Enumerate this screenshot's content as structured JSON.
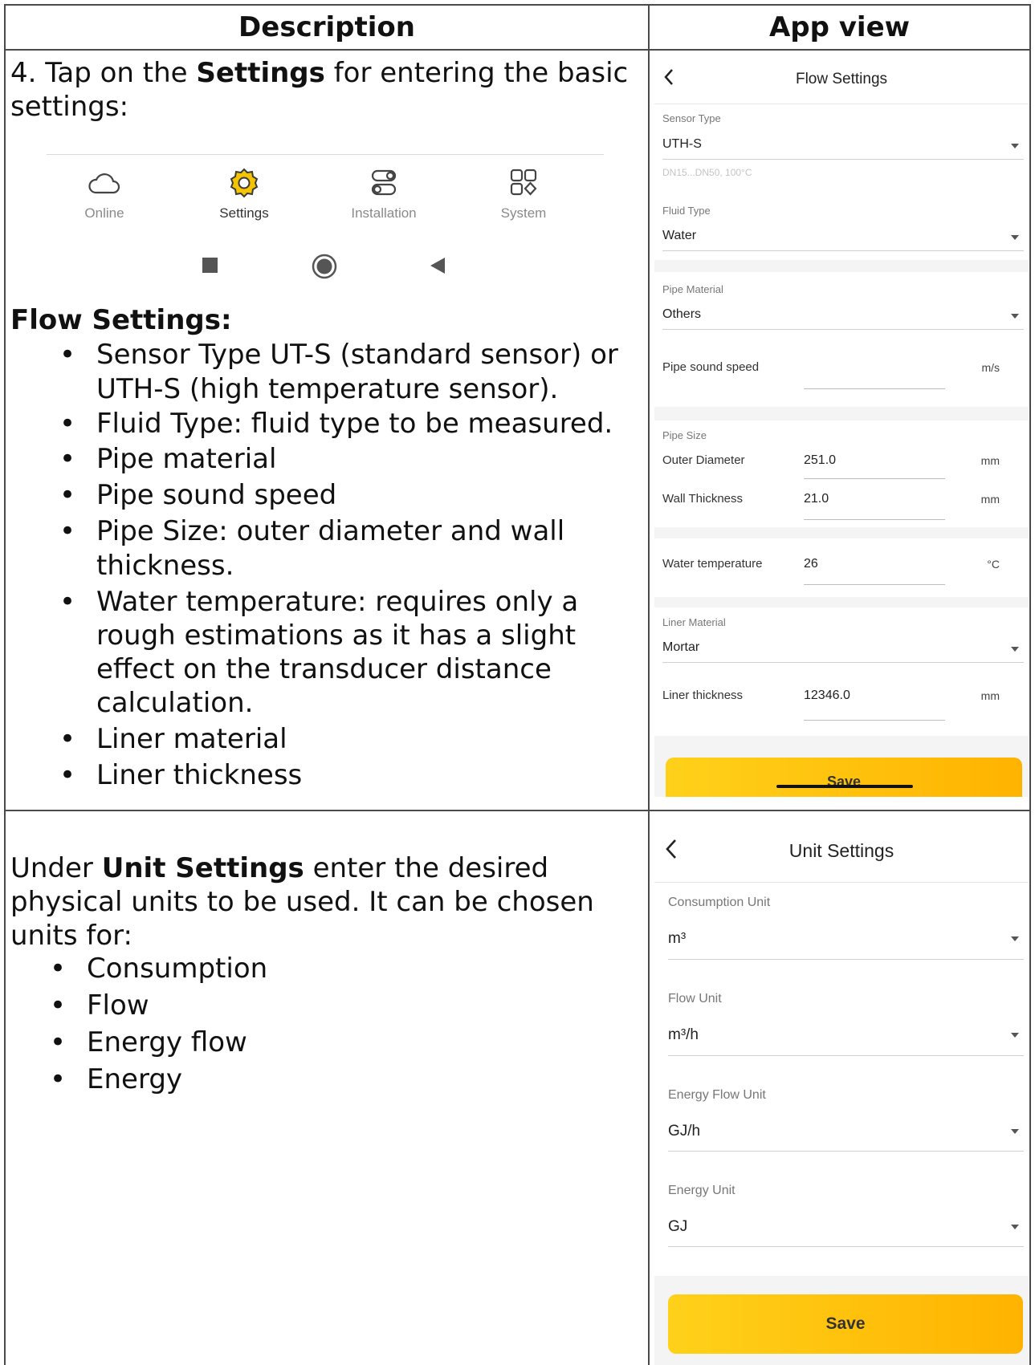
{
  "headers": {
    "description": "Description",
    "app_view": "App view"
  },
  "row1": {
    "intro_prefix": "4. Tap on the ",
    "intro_bold": "Settings",
    "intro_suffix": " for entering the basic settings:",
    "nav": [
      {
        "label": "Online",
        "icon": "cloud-icon"
      },
      {
        "label": "Settings",
        "icon": "gear-icon"
      },
      {
        "label": "Installation",
        "icon": "installation-icon"
      },
      {
        "label": "System",
        "icon": "grid-icon"
      }
    ],
    "flow_heading": "Flow Settings:",
    "bullets": [
      "Sensor Type UT-S (standard sensor) or UTH-S (high temperature sensor).",
      "Fluid Type: fluid type to be measured.",
      "Pipe material",
      "Pipe sound speed",
      "Pipe Size: outer diameter and wall thickness.",
      "Water temperature: requires only a rough estimations as it has a slight effect on the transducer distance calculation.",
      "Liner material",
      "Liner thickness"
    ]
  },
  "flow_screen": {
    "title": "Flow Settings",
    "sensor_type_caption": "Sensor Type",
    "sensor_type_value": "UTH-S",
    "sensor_hint": "DN15...DN50, 100°C",
    "fluid_type_caption": "Fluid Type",
    "fluid_type_value": "Water",
    "pipe_material_caption": "Pipe Material",
    "pipe_material_value": "Others",
    "pipe_sound_speed_label": "Pipe sound speed",
    "pipe_sound_speed_value": "",
    "pipe_sound_speed_unit": "m/s",
    "pipe_size_caption": "Pipe Size",
    "outer_diameter_label": "Outer Diameter",
    "outer_diameter_value": "251.0",
    "outer_diameter_unit": "mm",
    "wall_thickness_label": "Wall Thickness",
    "wall_thickness_value": "21.0",
    "wall_thickness_unit": "mm",
    "water_temp_label": "Water temperature",
    "water_temp_value": "26",
    "water_temp_unit": "°C",
    "liner_material_caption": "Liner Material",
    "liner_material_value": "Mortar",
    "liner_thickness_label": "Liner thickness",
    "liner_thickness_value": "12346.0",
    "liner_thickness_unit": "mm",
    "save_label": "Save"
  },
  "row2": {
    "intro_prefix": "Under ",
    "intro_bold": "Unit Settings",
    "intro_suffix": " enter the desired physical units to be used. It can be chosen units for:",
    "bullets": [
      "Consumption",
      "Flow",
      "Energy flow",
      "Energy"
    ]
  },
  "unit_screen": {
    "title": "Unit Settings",
    "consumption_caption": "Consumption Unit",
    "consumption_value": "m³",
    "flow_caption": "Flow Unit",
    "flow_value": "m³/h",
    "energy_flow_caption": "Energy Flow Unit",
    "energy_flow_value": "GJ/h",
    "energy_caption": "Energy Unit",
    "energy_value": "GJ",
    "save_label": "Save"
  },
  "colors": {
    "accent_start": "#ffd11a",
    "accent_end": "#ffb300",
    "gear_fill": "#f5c400"
  }
}
